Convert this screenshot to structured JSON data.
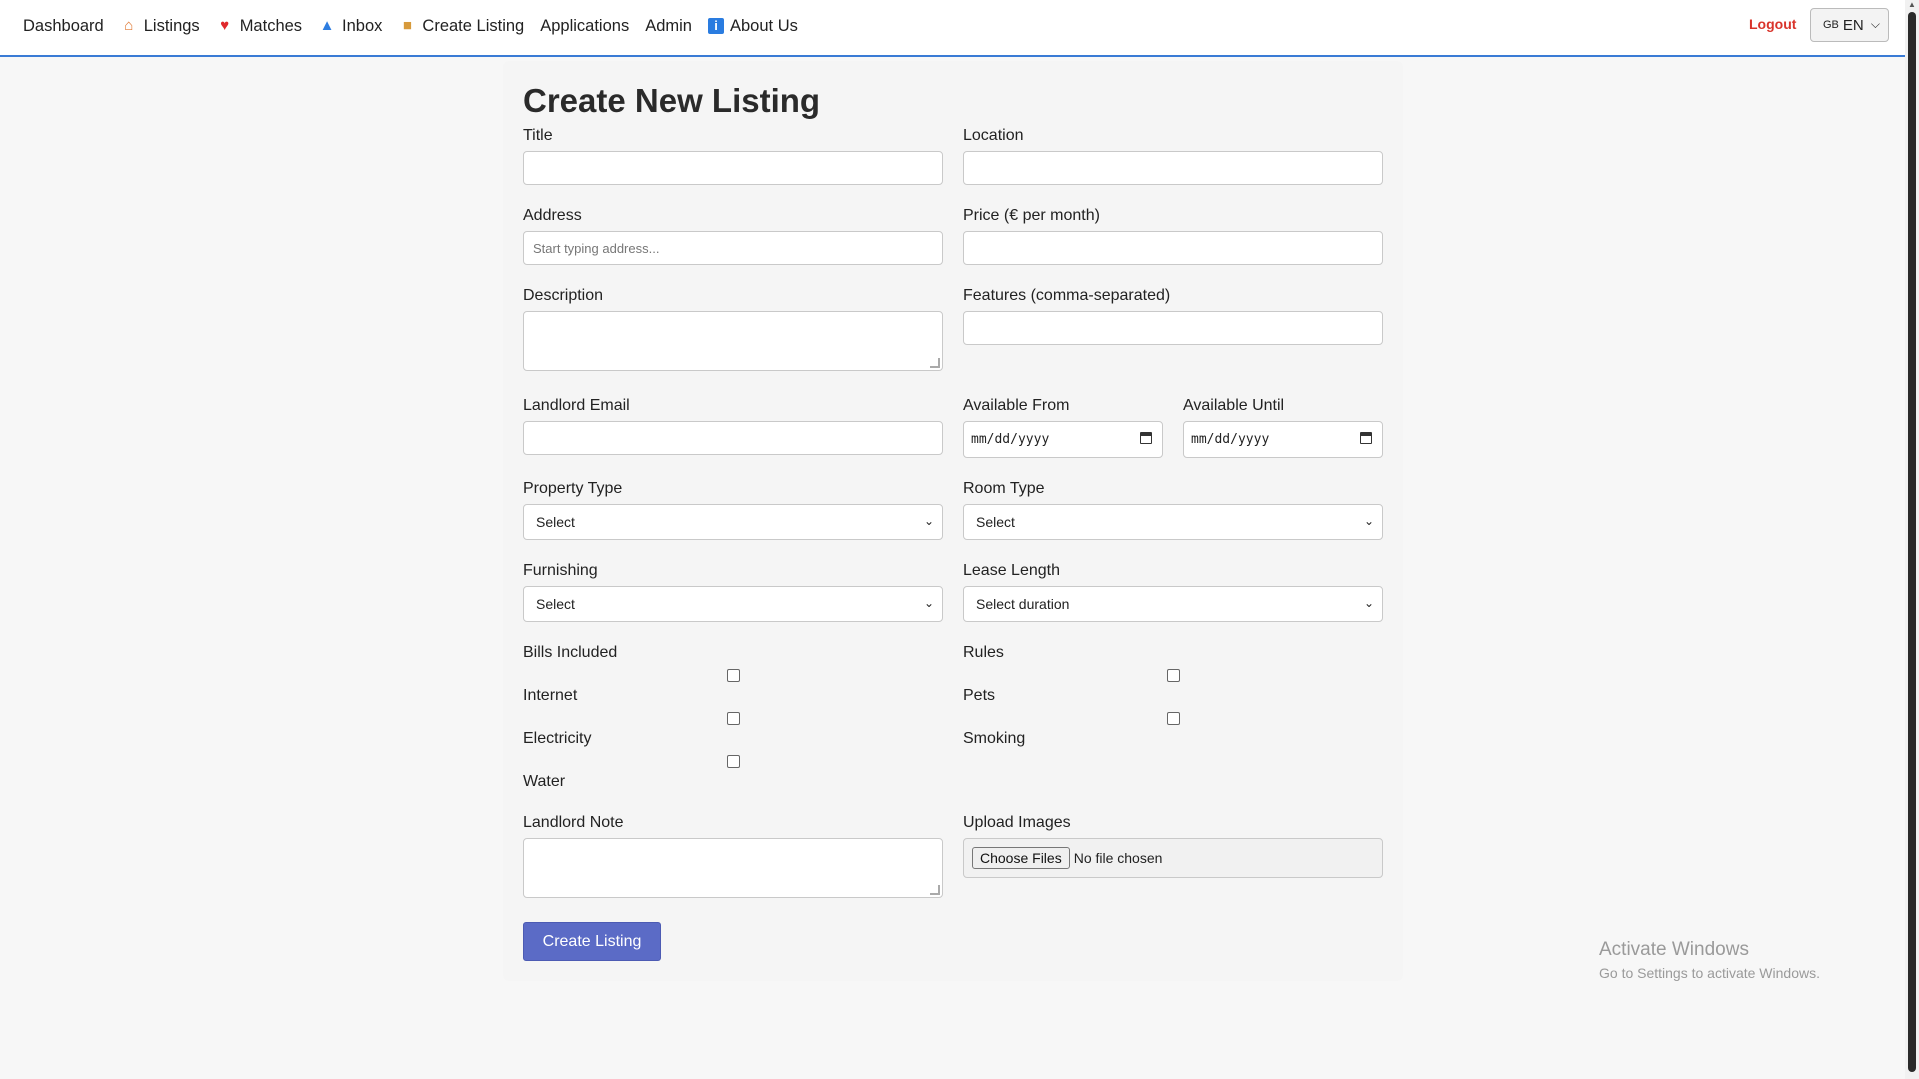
{
  "nav": {
    "dashboard": "Dashboard",
    "listings": "Listings",
    "matches": "Matches",
    "inbox": "Inbox",
    "create_listing": "Create Listing",
    "applications": "Applications",
    "admin": "Admin",
    "about": "About Us",
    "logout": "Logout",
    "lang_flag": "GB",
    "lang_value": "EN"
  },
  "form": {
    "title": "Create New Listing",
    "labels": {
      "title": "Title",
      "location": "Location",
      "address": "Address",
      "price": "Price (€ per month)",
      "description": "Description",
      "features": "Features (comma-separated)",
      "landlord_email": "Landlord Email",
      "available_from": "Available From",
      "available_until": "Available Until",
      "property_type": "Property Type",
      "room_type": "Room Type",
      "furnishing": "Furnishing",
      "lease_length": "Lease Length",
      "bills_included": "Bills Included",
      "internet": "Internet",
      "electricity": "Electricity",
      "water": "Water",
      "rules": "Rules",
      "pets": "Pets",
      "smoking": "Smoking",
      "landlord_note": "Landlord Note",
      "upload_images": "Upload Images"
    },
    "placeholders": {
      "address": "Start typing address..."
    },
    "date_placeholder": "mm/dd/yyyy",
    "selects": {
      "property_type": "Select",
      "room_type": "Select",
      "furnishing": "Select",
      "lease_length": "Select duration"
    },
    "file": {
      "button": "Choose Files",
      "status": "No file chosen"
    },
    "submit": "Create Listing"
  },
  "watermark": {
    "line1": "Activate Windows",
    "line2": "Go to Settings to activate Windows."
  }
}
